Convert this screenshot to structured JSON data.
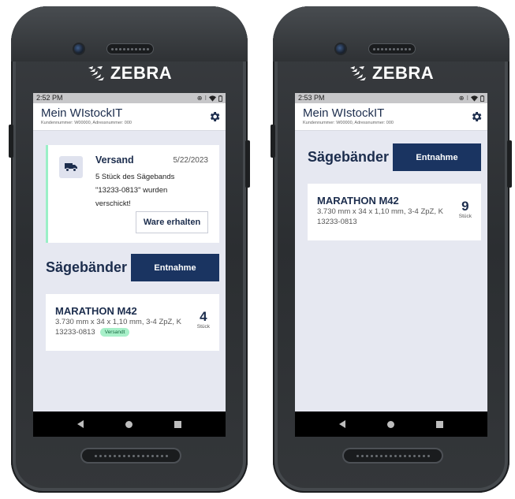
{
  "left_device": {
    "brand": "ZEBRA",
    "status": {
      "time": "2:52 PM",
      "icons": [
        "link-icon",
        "vibrate-icon",
        "wifi-icon",
        "battery-icon"
      ]
    },
    "appbar": {
      "title": "Mein WIstockIT",
      "subtitle": "Kundennummer: W00000, Adressnummer: 000",
      "settings_icon": "gear-icon"
    },
    "notification": {
      "icon": "truck-icon",
      "title": "Versand",
      "date": "5/22/2023",
      "body": "5 Stück des Sägebands \"13233-0813\" wurden verschickt!",
      "button_label": "Ware erhalten",
      "accent_color": "#9af0c7"
    },
    "section": {
      "title": "Sägebänder",
      "button_label": "Entnahme"
    },
    "product": {
      "name": "MARATHON M42",
      "spec": "3.730 mm x 34 x 1,10 mm, 3-4 ZpZ, K",
      "code": "13233-0813",
      "badge": "Versandt",
      "qty": "4",
      "unit": "Stück"
    }
  },
  "right_device": {
    "brand": "ZEBRA",
    "status": {
      "time": "2:53 PM",
      "icons": [
        "link-icon",
        "vibrate-icon",
        "wifi-icon",
        "battery-icon"
      ]
    },
    "appbar": {
      "title": "Mein WIstockIT",
      "subtitle": "Kundennummer: W00000, Adressnummer: 000",
      "settings_icon": "gear-icon"
    },
    "section": {
      "title": "Sägebänder",
      "button_label": "Entnahme"
    },
    "product": {
      "name": "MARATHON M42",
      "spec": "3.730 mm x 34 x 1,10 mm, 3-4 ZpZ, K",
      "code": "13233-0813",
      "qty": "9",
      "unit": "Stück"
    }
  },
  "colors": {
    "primary": "#1a3461",
    "text_dark": "#1c2d4d",
    "background": "#e6e8f1",
    "badge_bg": "#a8f0c9"
  }
}
